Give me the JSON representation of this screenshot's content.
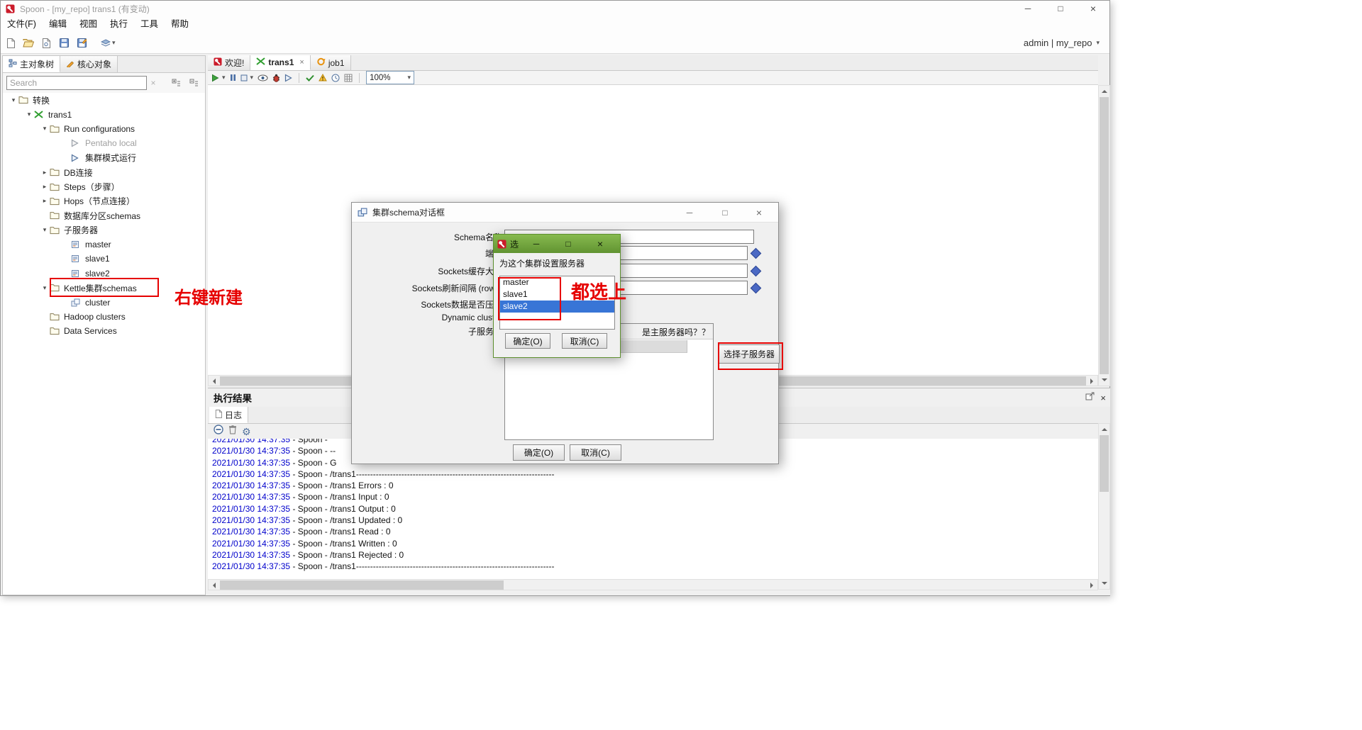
{
  "window": {
    "title": "Spoon - [my_repo] trans1 (有变动)"
  },
  "glyphs": {
    "min": "─",
    "max": "□",
    "close": "×",
    "caret_down": "▾",
    "chev_right": "▸",
    "chev_down": "▾",
    "clear": "×",
    "gear": "⚙"
  },
  "menubar": {
    "items": [
      {
        "label": "文件(F)"
      },
      {
        "label": "编辑"
      },
      {
        "label": "视图"
      },
      {
        "label": "执行"
      },
      {
        "label": "工具"
      },
      {
        "label": "帮助"
      }
    ]
  },
  "toolbar": {
    "user_label": "admin | my_repo"
  },
  "left_panel": {
    "tabs": [
      {
        "label": "主对象树"
      },
      {
        "label": "核心对象"
      }
    ],
    "search": {
      "placeholder": "Search"
    },
    "tree": [
      {
        "label": "转换"
      },
      {
        "label": "trans1"
      },
      {
        "label": "Run configurations"
      },
      {
        "label": "Pentaho local"
      },
      {
        "label": "集群模式运行"
      },
      {
        "label": "DB连接"
      },
      {
        "label": "Steps（步骤）"
      },
      {
        "label": "Hops（节点连接）"
      },
      {
        "label": "数据库分区schemas"
      },
      {
        "label": "子服务器"
      },
      {
        "label": "master"
      },
      {
        "label": "slave1"
      },
      {
        "label": "slave2"
      },
      {
        "label": "Kettle集群schemas"
      },
      {
        "label": "cluster"
      },
      {
        "label": "Hadoop clusters"
      },
      {
        "label": "Data Services"
      }
    ]
  },
  "main": {
    "tabs": [
      {
        "label": "欢迎!"
      },
      {
        "label": "trans1"
      },
      {
        "label": "job1"
      }
    ],
    "zoom": "100%"
  },
  "results": {
    "title": "执行结果",
    "tab": "日志",
    "log": [
      {
        "ts": "2021/01/30 14:37:35",
        "msg": " - Spoon - "
      },
      {
        "ts": "2021/01/30 14:37:35",
        "msg": " - Spoon - --"
      },
      {
        "ts": "2021/01/30 14:37:35",
        "msg": " - Spoon - G"
      },
      {
        "ts": "2021/01/30 14:37:35",
        "msg": " - Spoon - /trans1----------------------------------------------------------------------"
      },
      {
        "ts": "2021/01/30 14:37:35",
        "msg": " - Spoon - /trans1 Errors : 0"
      },
      {
        "ts": "2021/01/30 14:37:35",
        "msg": " - Spoon - /trans1 Input : 0"
      },
      {
        "ts": "2021/01/30 14:37:35",
        "msg": " - Spoon - /trans1 Output : 0"
      },
      {
        "ts": "2021/01/30 14:37:35",
        "msg": " - Spoon - /trans1 Updated : 0"
      },
      {
        "ts": "2021/01/30 14:37:35",
        "msg": " - Spoon - /trans1 Read : 0"
      },
      {
        "ts": "2021/01/30 14:37:35",
        "msg": " - Spoon - /trans1 Written : 0"
      },
      {
        "ts": "2021/01/30 14:37:35",
        "msg": " - Spoon - /trans1 Rejected : 0"
      },
      {
        "ts": "2021/01/30 14:37:35",
        "msg": " - Spoon - /trans1----------------------------------------------------------------------"
      }
    ]
  },
  "cluster_dialog": {
    "title": "集群schema对话框",
    "fields": {
      "schema_name": "Schema名称",
      "port": "端口",
      "sockets_buffer": "Sockets缓存大小",
      "sockets_flush": "Sockets刷新间隔 (rows)",
      "sockets_compress": "Sockets数据是否压缩",
      "dynamic_cluster": "Dynamic cluster",
      "slave_servers": "子服务器"
    },
    "table": {
      "master_col": "是主服务器吗？？"
    },
    "buttons": {
      "select_slaves": "选择子服务器",
      "ok": "确定(O)",
      "cancel": "取消(C)"
    }
  },
  "select_dialog": {
    "title": "选",
    "message": "为这个集群设置服务器",
    "items": [
      {
        "label": "master"
      },
      {
        "label": "slave1"
      },
      {
        "label": "slave2"
      }
    ],
    "buttons": {
      "ok": "确定(O)",
      "cancel": "取消(C)"
    }
  },
  "annotations": {
    "tree_note": "右键新建",
    "list_note": "都选上"
  },
  "colors": {
    "annotation_red": "#e60000",
    "selection_blue": "#3875d6",
    "title_green": "#619331",
    "log_ts_blue": "#0000cc"
  }
}
